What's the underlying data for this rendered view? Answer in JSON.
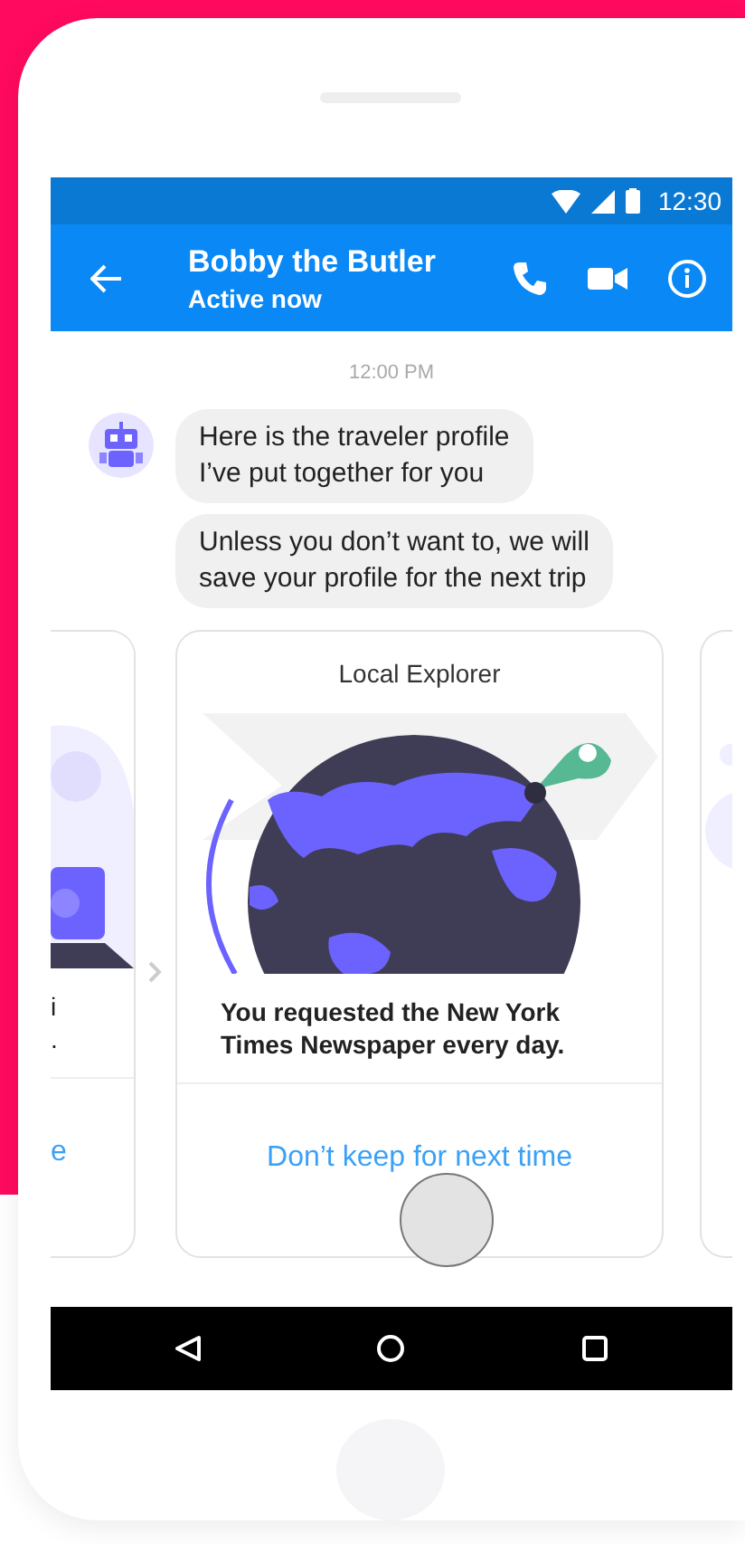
{
  "status_bar": {
    "time": "12:30"
  },
  "header": {
    "title": "Bobby the Butler",
    "subtitle": "Active now"
  },
  "timestamp": "12:00 PM",
  "messages": [
    {
      "text": "Here is the traveler profile\nI’ve put together for you"
    },
    {
      "text": "Unless you don’t want to, we will\nsave your profile for the next trip"
    }
  ],
  "cards": [
    {
      "kind": "left",
      "description": "i\n.",
      "action": "e"
    },
    {
      "kind": "main",
      "title": "Local Explorer",
      "description": "You requested the New York\nTimes Newspaper every day.",
      "action": "Don’t keep for next time"
    },
    {
      "kind": "right"
    }
  ]
}
